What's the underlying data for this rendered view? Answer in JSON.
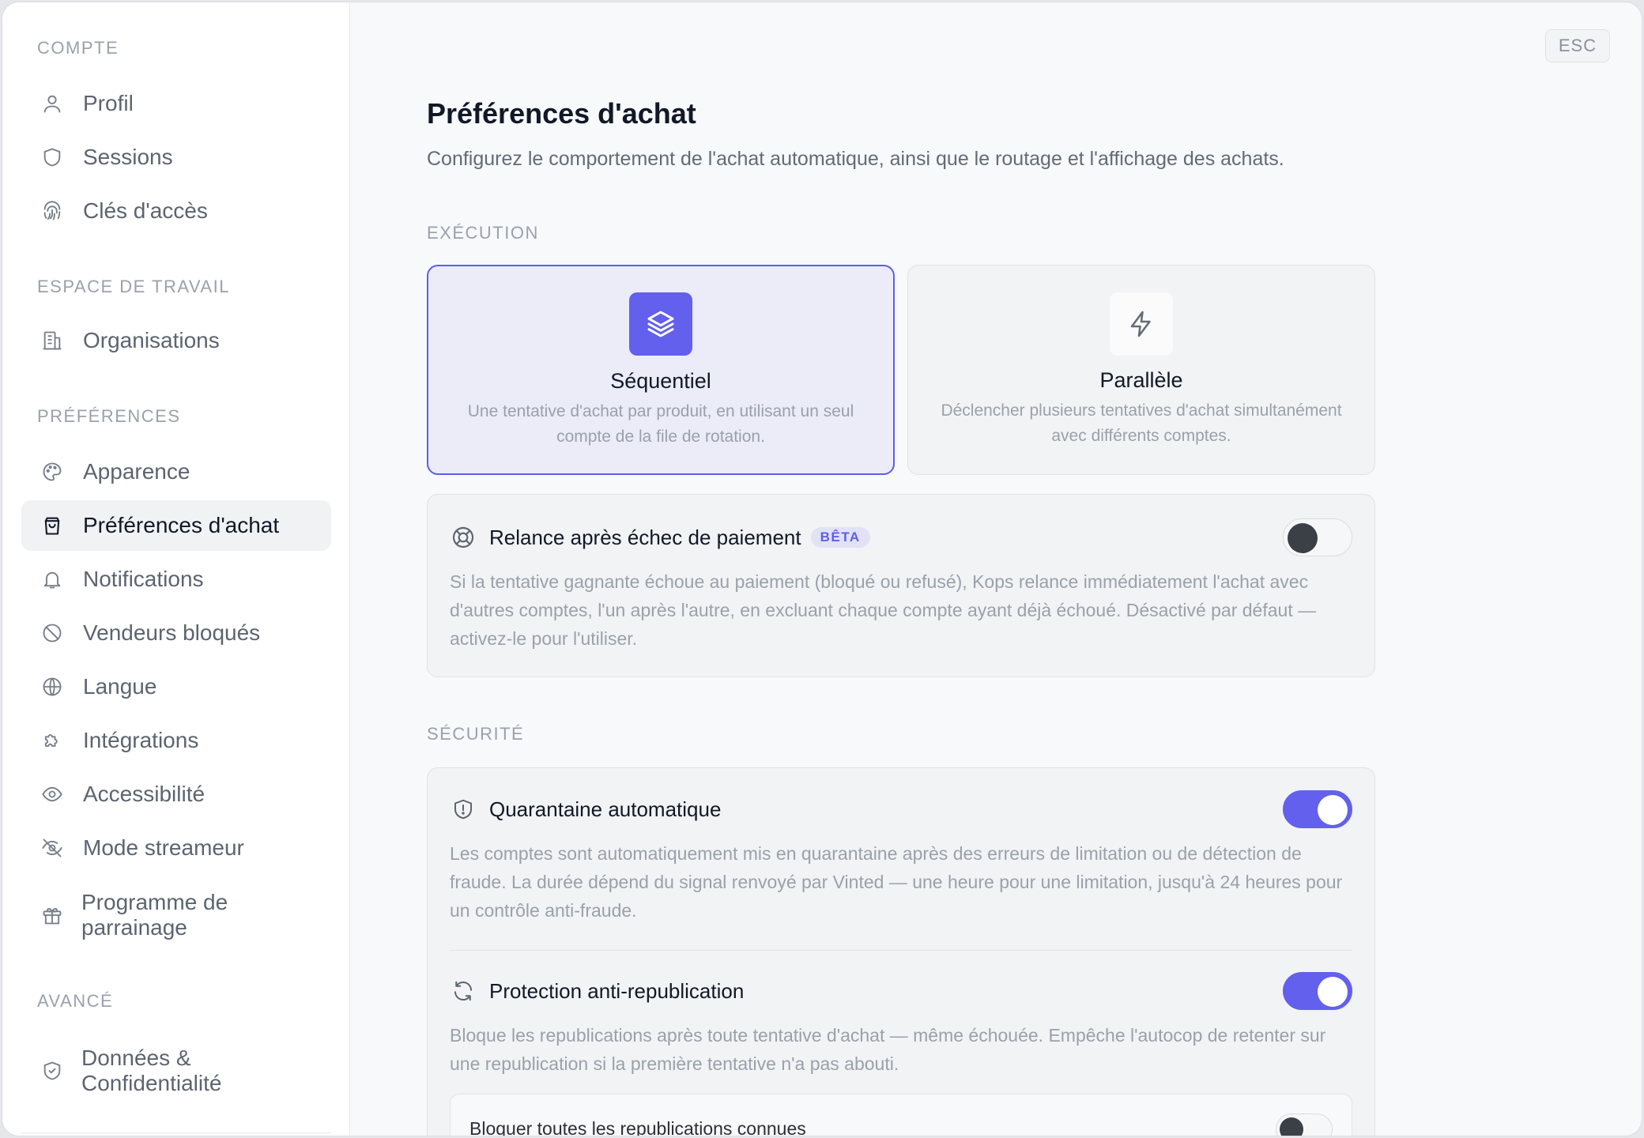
{
  "sidebar": {
    "sections": {
      "account": "COMPTE",
      "workspace": "ESPACE DE TRAVAIL",
      "preferences": "PRÉFÉRENCES",
      "advanced": "AVANCÉ"
    },
    "items": {
      "profile": "Profil",
      "sessions": "Sessions",
      "access_keys": "Clés d'accès",
      "organisations": "Organisations",
      "appearance": "Apparence",
      "purchase_prefs": "Préférences d'achat",
      "notifications": "Notifications",
      "blocked_sellers": "Vendeurs bloqués",
      "language": "Langue",
      "integrations": "Intégrations",
      "accessibility": "Accessibilité",
      "streamer_mode": "Mode streameur",
      "referral_l1": "Programme de",
      "referral_l2": "parrainage",
      "privacy_l1": "Données &",
      "privacy_l2": "Confidentialité"
    },
    "active_item": "purchase_prefs"
  },
  "main": {
    "esc_label": "ESC",
    "title": "Préférences d'achat",
    "subtitle": "Configurez le comportement de l'achat automatique, ainsi que le routage et l'affichage des achats.",
    "execution": {
      "label": "EXÉCUTION",
      "selected": "sequential",
      "sequential": {
        "title": "Séquentiel",
        "desc": "Une tentative d'achat par produit, en utilisant un seul compte de la file de rotation."
      },
      "parallel": {
        "title": "Parallèle",
        "desc": "Déclencher plusieurs tentatives d'achat simultanément avec différents comptes."
      },
      "retry": {
        "title": "Relance après échec de paiement",
        "badge": "BÊTA",
        "enabled": false,
        "desc": "Si la tentative gagnante échoue au paiement (bloqué ou refusé), Kops relance immédiatement l'achat avec d'autres comptes, l'un après l'autre, en excluant chaque compte ayant déjà échoué. Désactivé par défaut — activez-le pour l'utiliser."
      }
    },
    "security": {
      "label": "SÉCURITÉ",
      "quarantine": {
        "title": "Quarantaine automatique",
        "enabled": true,
        "desc": "Les comptes sont automatiquement mis en quarantaine après des erreurs de limitation ou de détection de fraude. La durée dépend du signal renvoyé par Vinted — une heure pour une limitation, jusqu'à 24 heures pour un contrôle anti-fraude."
      },
      "anti_repost": {
        "title": "Protection anti-republication",
        "enabled": true,
        "desc": "Bloque les republications après toute tentative d'achat — même échouée. Empêche l'autocop de retenter sur une republication si la première tentative n'a pas abouti."
      },
      "block_all": {
        "title": "Bloquer toutes les republications connues",
        "enabled": false
      }
    }
  }
}
